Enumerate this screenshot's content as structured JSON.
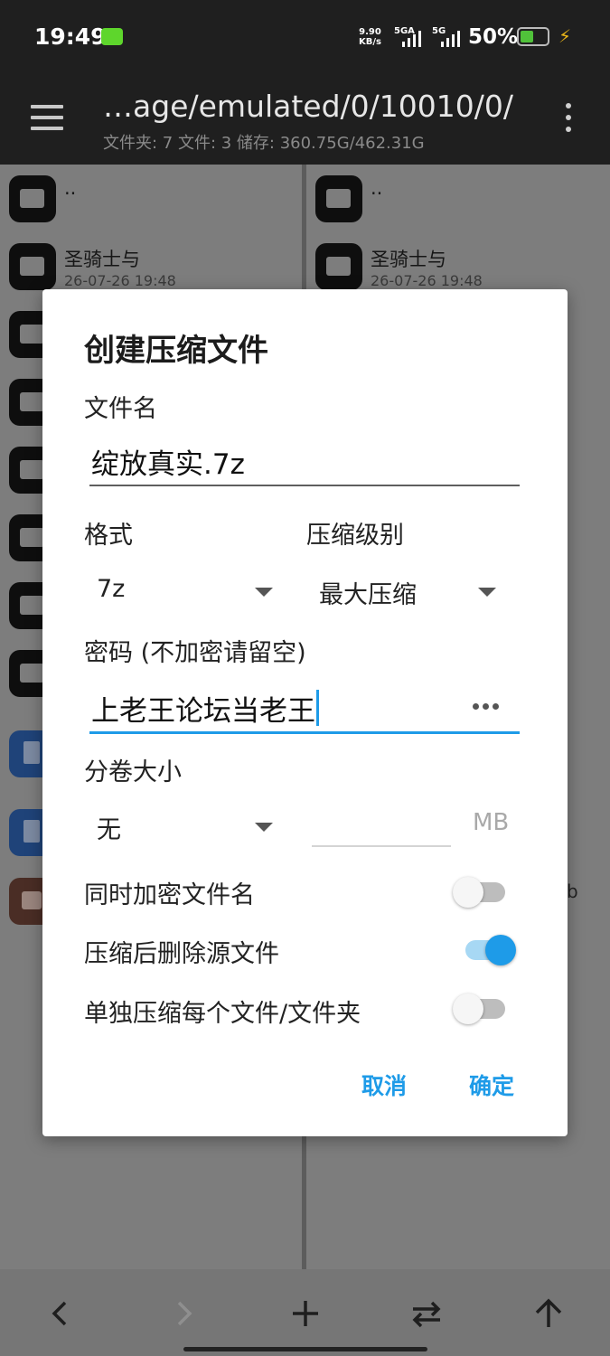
{
  "status_bar": {
    "time": "19:49",
    "speed_value": "9.90",
    "speed_unit": "KB/s",
    "sim1_net": "5GA",
    "sim2_net": "5G",
    "battery_percent": "50%",
    "battery_level": 0.5,
    "colors": {
      "battery_fill": "#50c23a",
      "charging": "#e8b418",
      "app_badge": "#5ed62c"
    }
  },
  "app_bar": {
    "path": "…age/emulated/0/10010/0/",
    "stats": "文件夹: 7   文件: 3   储存: 360.75G/462.31G"
  },
  "left_pane": {
    "items": [
      {
        "name": "..",
        "date": ""
      },
      {
        "name": "圣骑士与",
        "date": "26-07-26 19:48"
      }
    ]
  },
  "right_pane": {
    "items": [
      {
        "name": "..",
        "date": ""
      },
      {
        "name": "圣骑士与",
        "date": "26-07-26 19:48"
      }
    ],
    "stray_text": "b"
  },
  "dialog": {
    "title": "创建压缩文件",
    "filename_label": "文件名",
    "filename_value": "绽放真实.7z",
    "format_label": "格式",
    "format_value": "7z",
    "level_label": "压缩级别",
    "level_value": "最大压缩",
    "password_label": "密码 (不加密请留空)",
    "password_value": "上老王论坛当老王",
    "split_label": "分卷大小",
    "split_value": "无",
    "split_unit": "MB",
    "toggles": [
      {
        "label": "同时加密文件名",
        "on": false
      },
      {
        "label": "压缩后删除源文件",
        "on": true
      },
      {
        "label": "单独压缩每个文件/文件夹",
        "on": false
      }
    ],
    "cancel_label": "取消",
    "ok_label": "确定",
    "accent_color": "#1e9be8"
  },
  "bottom_bar": {
    "buttons": [
      "back-icon",
      "forward-icon",
      "add-icon",
      "swap-icon",
      "up-icon"
    ]
  }
}
